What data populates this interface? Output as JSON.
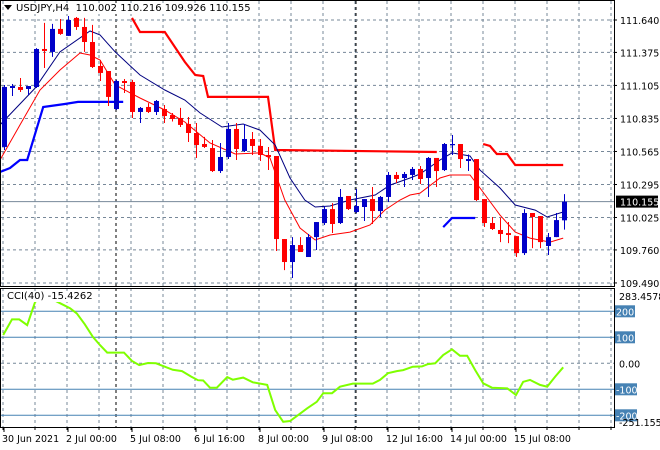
{
  "header": {
    "symbol": "USDJPY,H4",
    "open": "110.002",
    "high": "110.216",
    "low": "109.926",
    "close": "110.155"
  },
  "price_axis": {
    "labels": [
      "111.640",
      "111.375",
      "111.105",
      "110.835",
      "110.565",
      "110.295",
      "110.025",
      "109.760",
      "109.490"
    ],
    "current": "110.155"
  },
  "cci": {
    "label": "CCI(40)",
    "value": "-15.4262",
    "max_label": "283.4578",
    "min_label": "-251.1553",
    "levels": [
      "200",
      "100",
      "0.00",
      "-100",
      "-200"
    ]
  },
  "time_axis": {
    "labels": [
      "30 Jun 2021",
      "2 Jul 00:00",
      "5 Jul 08:00",
      "6 Jul 16:00",
      "8 Jul 00:00",
      "9 Jul 08:00",
      "12 Jul 16:00",
      "14 Jul 00:00",
      "15 Jul 08:00"
    ]
  },
  "colors": {
    "bull": "#0000c8",
    "bear": "#ff0000",
    "ma_fast": "#000080",
    "ma_slow": "#ff0000",
    "stop_red": "#ff0000",
    "stop_blue": "#0000ff",
    "cci": "#7fff00",
    "level": "#4682b4",
    "grid": "#778899"
  },
  "chart_data": {
    "type": "candlestick",
    "symbol": "USDJPY",
    "timeframe": "H4",
    "ylim": [
      109.49,
      111.64
    ],
    "candles": [
      [
        110.602,
        111.109,
        110.577,
        111.092
      ],
      [
        111.084,
        111.117,
        111.019,
        111.1
      ],
      [
        111.092,
        111.166,
        111.051,
        111.068
      ],
      [
        111.076,
        111.1,
        111.027,
        111.1
      ],
      [
        111.092,
        111.41,
        111.084,
        111.403
      ],
      [
        111.403,
        111.616,
        111.248,
        111.387
      ],
      [
        111.379,
        111.608,
        111.338,
        111.567
      ],
      [
        111.567,
        111.648,
        111.518,
        111.526
      ],
      [
        111.51,
        111.673,
        111.51,
        111.64
      ],
      [
        111.657,
        111.665,
        111.559,
        111.583
      ],
      [
        111.583,
        111.657,
        111.379,
        111.46
      ],
      [
        111.46,
        111.6,
        111.248,
        111.256
      ],
      [
        111.264,
        111.313,
        111.141,
        111.207
      ],
      [
        111.223,
        111.223,
        110.937,
        111.011
      ],
      [
        110.912,
        111.15,
        110.904,
        111.141
      ],
      [
        111.141,
        111.158,
        111.043,
        111.125
      ],
      [
        111.133,
        111.15,
        110.839,
        110.888
      ],
      [
        110.888,
        110.929,
        110.798,
        110.921
      ],
      [
        110.929,
        110.96,
        110.88,
        110.888
      ],
      [
        110.888,
        110.986,
        110.863,
        110.978
      ],
      [
        110.912,
        110.945,
        110.798,
        110.855
      ],
      [
        110.863,
        110.88,
        110.81,
        110.831
      ],
      [
        110.839,
        110.921,
        110.765,
        110.782
      ],
      [
        110.79,
        110.847,
        110.642,
        110.716
      ],
      [
        110.716,
        110.798,
        110.512,
        110.618
      ],
      [
        110.626,
        110.684,
        110.593,
        110.602
      ],
      [
        110.593,
        110.659,
        110.397,
        110.405
      ],
      [
        110.405,
        110.634,
        110.389,
        110.52
      ],
      [
        110.52,
        110.798,
        110.503,
        110.749
      ],
      [
        110.749,
        110.798,
        110.495,
        110.585
      ],
      [
        110.569,
        110.79,
        110.561,
        110.667
      ],
      [
        110.667,
        110.724,
        110.536,
        110.61
      ],
      [
        110.61,
        110.667,
        110.487,
        110.536
      ],
      [
        110.536,
        110.602,
        110.413,
        110.52
      ],
      [
        110.528,
        110.528,
        109.751,
        109.849
      ],
      [
        109.849,
        109.849,
        109.595,
        109.661
      ],
      [
        109.661,
        109.865,
        109.53,
        109.8
      ],
      [
        109.8,
        109.865,
        109.743,
        109.743
      ],
      [
        109.702,
        109.89,
        109.702,
        109.865
      ],
      [
        109.865,
        109.988,
        109.759,
        109.988
      ],
      [
        109.98,
        110.119,
        109.964,
        110.094
      ],
      [
        110.094,
        110.143,
        109.898,
        109.972
      ],
      [
        109.98,
        110.258,
        109.972,
        110.193
      ],
      [
        110.201,
        110.201,
        110.086,
        110.094
      ],
      [
        110.07,
        110.258,
        110.062,
        110.119
      ],
      [
        110.111,
        110.176,
        109.996,
        110.176
      ],
      [
        110.176,
        110.274,
        109.972,
        110.078
      ],
      [
        110.078,
        110.201,
        110.029,
        110.193
      ],
      [
        110.193,
        110.397,
        110.152,
        110.373
      ],
      [
        110.373,
        110.397,
        110.307,
        110.34
      ],
      [
        110.348,
        110.397,
        110.274,
        110.381
      ],
      [
        110.373,
        110.438,
        110.332,
        110.422
      ],
      [
        110.422,
        110.446,
        110.299,
        110.34
      ],
      [
        110.348,
        110.52,
        110.193,
        110.512
      ],
      [
        110.512,
        110.512,
        110.274,
        110.405
      ],
      [
        110.413,
        110.634,
        110.405,
        110.626
      ],
      [
        110.618,
        110.7,
        110.536,
        110.626
      ],
      [
        110.626,
        110.626,
        110.43,
        110.503
      ],
      [
        110.487,
        110.54,
        110.405,
        110.503
      ],
      [
        110.503,
        110.503,
        110.16,
        110.168
      ],
      [
        110.176,
        110.176,
        109.947,
        109.98
      ],
      [
        109.98,
        110.029,
        109.923,
        109.931
      ],
      [
        109.923,
        110.021,
        109.824,
        109.89
      ],
      [
        109.898,
        109.988,
        109.816,
        109.882
      ],
      [
        109.873,
        109.873,
        109.702,
        109.734
      ],
      [
        109.734,
        110.094,
        109.718,
        110.062
      ],
      [
        110.062,
        110.062,
        109.775,
        110.029
      ],
      [
        110.037,
        110.037,
        109.775,
        109.824
      ],
      [
        109.792,
        109.898,
        109.718,
        109.865
      ],
      [
        109.865,
        110.062,
        109.865,
        110.004
      ],
      [
        110.002,
        110.216,
        109.926,
        110.155
      ]
    ],
    "ma_fast": [
      [
        -0.5,
        110.782
      ],
      [
        3.9,
        111.084
      ],
      [
        7,
        111.379
      ],
      [
        10.75,
        111.55
      ],
      [
        12,
        111.518
      ],
      [
        13.9,
        111.379
      ],
      [
        17,
        111.19
      ],
      [
        20.1,
        111.068
      ],
      [
        22.6,
        110.986
      ],
      [
        24.5,
        110.88
      ],
      [
        27.25,
        110.765
      ],
      [
        29.9,
        110.79
      ],
      [
        32,
        110.74
      ],
      [
        33.9,
        110.618
      ],
      [
        35.75,
        110.348
      ],
      [
        37.6,
        110.168
      ],
      [
        38.9,
        110.111
      ],
      [
        40.75,
        110.119
      ],
      [
        43.25,
        110.168
      ],
      [
        46.4,
        110.209
      ],
      [
        48.25,
        110.29
      ],
      [
        50.75,
        110.348
      ],
      [
        52,
        110.381
      ],
      [
        54.5,
        110.495
      ],
      [
        56,
        110.553
      ],
      [
        58.25,
        110.528
      ],
      [
        59.5,
        110.413
      ],
      [
        62,
        110.266
      ],
      [
        63.9,
        110.127
      ],
      [
        66.4,
        110.086
      ],
      [
        67.9,
        110.029
      ],
      [
        69.9,
        110.07
      ]
    ],
    "ma_slow": [
      [
        -0.5,
        110.495
      ],
      [
        2,
        110.782
      ],
      [
        4.5,
        111.068
      ],
      [
        7,
        111.231
      ],
      [
        9.5,
        111.37
      ],
      [
        10.75,
        111.354
      ],
      [
        12,
        111.313
      ],
      [
        13.9,
        111.109
      ],
      [
        17,
        111.002
      ],
      [
        20.1,
        110.904
      ],
      [
        22.6,
        110.806
      ],
      [
        25.75,
        110.634
      ],
      [
        28.9,
        110.544
      ],
      [
        32,
        110.553
      ],
      [
        33.25,
        110.512
      ],
      [
        35.1,
        110.168
      ],
      [
        37,
        109.939
      ],
      [
        38.9,
        109.841
      ],
      [
        40.75,
        109.882
      ],
      [
        43.25,
        109.906
      ],
      [
        45.75,
        109.964
      ],
      [
        47.6,
        110.086
      ],
      [
        49.5,
        110.168
      ],
      [
        50.75,
        110.209
      ],
      [
        52,
        110.225
      ],
      [
        54.5,
        110.348
      ],
      [
        55.75,
        110.373
      ],
      [
        58.25,
        110.373
      ],
      [
        59.5,
        110.266
      ],
      [
        62,
        110.045
      ],
      [
        63.9,
        109.906
      ],
      [
        65.75,
        109.857
      ],
      [
        68.25,
        109.824
      ],
      [
        69.9,
        109.857
      ]
    ],
    "stop_red": [
      [
        [
          16,
          111.657
        ],
        [
          17,
          111.542
        ],
        [
          20.1,
          111.542
        ],
        [
          22.6,
          111.297
        ],
        [
          23.9,
          111.19
        ],
        [
          24.9,
          111.182
        ],
        [
          25.5,
          111.011
        ],
        [
          33,
          111.011
        ],
        [
          33.9,
          110.577
        ],
        [
          54.1,
          110.561
        ]
      ],
      [
        [
          59.9,
          110.626
        ],
        [
          60.75,
          110.61
        ],
        [
          61.6,
          110.544
        ],
        [
          62.9,
          110.544
        ],
        [
          63.9,
          110.454
        ],
        [
          69.9,
          110.454
        ]
      ]
    ],
    "stop_blue": [
      [
        [
          -0.5,
          110.397
        ],
        [
          0.75,
          110.43
        ],
        [
          2,
          110.495
        ],
        [
          2.9,
          110.495
        ],
        [
          4.9,
          110.929
        ],
        [
          7.6,
          110.953
        ],
        [
          9.25,
          110.97
        ],
        [
          14.9,
          110.97
        ]
      ],
      [
        [
          54.9,
          109.947
        ],
        [
          56,
          110.021
        ],
        [
          58.9,
          110.021
        ]
      ]
    ],
    "cci_series": [
      [
        -0.1,
        109
      ],
      [
        1,
        169
      ],
      [
        1.9,
        169
      ],
      [
        2.9,
        147
      ],
      [
        3.9,
        237
      ],
      [
        4.9,
        252
      ],
      [
        6,
        247
      ],
      [
        7,
        231
      ],
      [
        8.25,
        212
      ],
      [
        9.1,
        192
      ],
      [
        10.1,
        150
      ],
      [
        11.1,
        102
      ],
      [
        12,
        70
      ],
      [
        12.9,
        41
      ],
      [
        13.9,
        41
      ],
      [
        15,
        41
      ],
      [
        16,
        9
      ],
      [
        16.9,
        -7
      ],
      [
        18,
        1
      ],
      [
        19,
        0
      ],
      [
        20.1,
        -13
      ],
      [
        21.1,
        -25
      ],
      [
        22.25,
        -30
      ],
      [
        23.4,
        -51
      ],
      [
        24.25,
        -65
      ],
      [
        24.9,
        -66
      ],
      [
        25.75,
        -94
      ],
      [
        26.6,
        -94
      ],
      [
        27.9,
        -53
      ],
      [
        28.6,
        -63
      ],
      [
        29.9,
        -55
      ],
      [
        31.1,
        -73
      ],
      [
        32.9,
        -83
      ],
      [
        33.9,
        -180
      ],
      [
        34.9,
        -225
      ],
      [
        35.75,
        -222
      ],
      [
        36.6,
        -203
      ],
      [
        37.9,
        -173
      ],
      [
        39.1,
        -148
      ],
      [
        39.9,
        -115
      ],
      [
        41,
        -115
      ],
      [
        42,
        -90
      ],
      [
        43.6,
        -78
      ],
      [
        46.1,
        -78
      ],
      [
        47,
        -64
      ],
      [
        48,
        -38
      ],
      [
        49.1,
        -30
      ],
      [
        49.9,
        -26
      ],
      [
        51.1,
        -13
      ],
      [
        52.25,
        -12
      ],
      [
        53,
        -3
      ],
      [
        53.9,
        0
      ],
      [
        54.9,
        32
      ],
      [
        56,
        54
      ],
      [
        57,
        29
      ],
      [
        57.9,
        29
      ],
      [
        58.9,
        -26
      ],
      [
        59.9,
        -77
      ],
      [
        61,
        -94
      ],
      [
        62.9,
        -96
      ],
      [
        64,
        -122
      ],
      [
        64.9,
        -71
      ],
      [
        65.75,
        -64
      ],
      [
        67,
        -83
      ],
      [
        67.9,
        -90
      ],
      [
        68.9,
        -51
      ],
      [
        69.9,
        -15.4262
      ]
    ],
    "cci_levels": [
      200,
      100,
      0,
      -100,
      -200
    ],
    "cci_range": [
      -251.1553,
      283.4578
    ]
  }
}
